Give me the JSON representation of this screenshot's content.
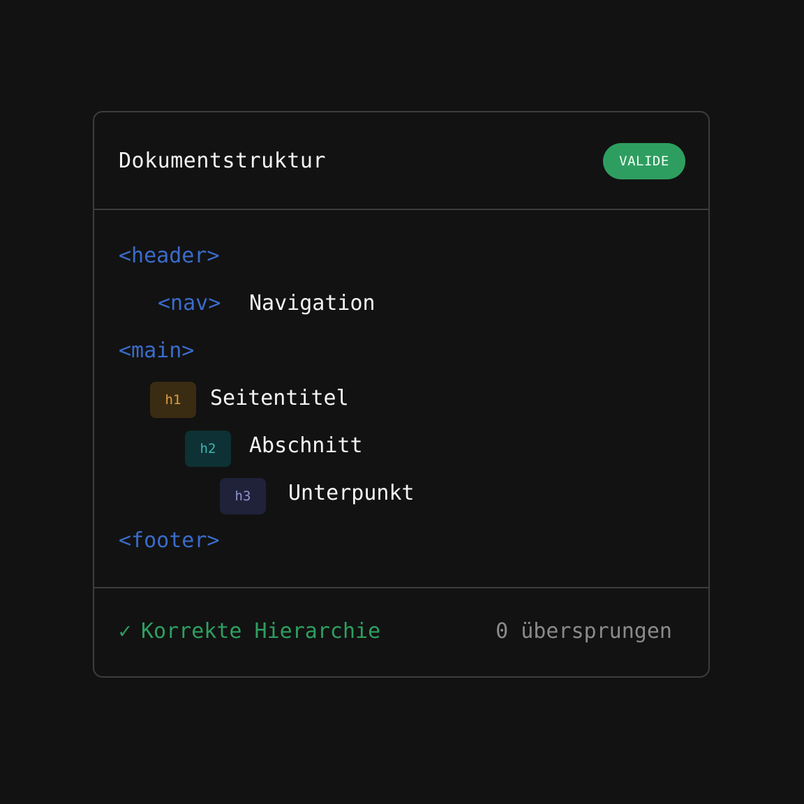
{
  "card": {
    "title": "Dokumentstruktur",
    "badge": "VALIDE"
  },
  "tree": {
    "header_tag": "<header>",
    "nav_tag": "<nav>",
    "nav_label": "Navigation",
    "main_tag": "<main>",
    "h1_chip": "h1",
    "h1_label": "Seitentitel",
    "h2_chip": "h2",
    "h2_label": "Abschnitt",
    "h3_chip": "h3",
    "h3_label": "Unterpunkt",
    "footer_tag": "<footer>"
  },
  "footer": {
    "check_icon": "✓",
    "status": "Korrekte Hierarchie",
    "skipped": "0 übersprungen"
  },
  "colors": {
    "background": "#121212",
    "border": "#3d3d3d",
    "tag": "#3a6ccb",
    "success": "#2e9e60",
    "h1": "#e0a040",
    "h2": "#3fb6b0",
    "h3": "#8e93d2",
    "muted": "#8a8a8a"
  }
}
